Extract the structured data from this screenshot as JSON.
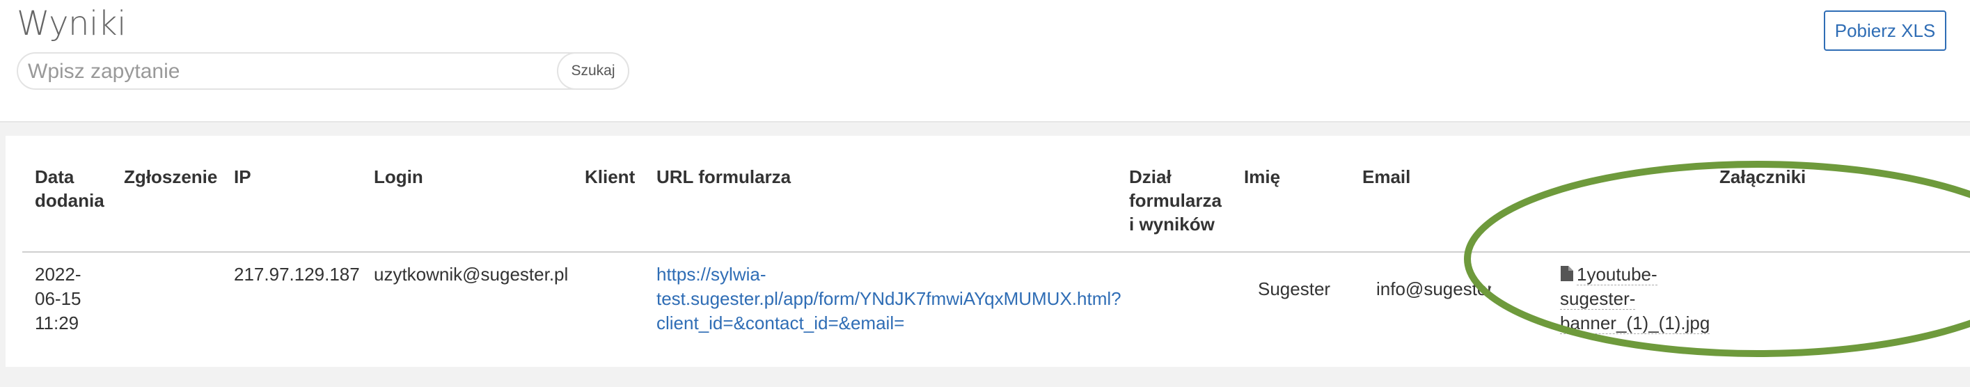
{
  "header": {
    "title": "Wyniki",
    "export_label": "Pobierz XLS"
  },
  "search": {
    "placeholder": "Wpisz zapytanie",
    "value": "",
    "button_label": "Szukaj"
  },
  "table": {
    "headers": {
      "date_line1": "Data",
      "date_line2": "dodania",
      "ticket": "Zgłoszenie",
      "ip": "IP",
      "login": "Login",
      "client": "Klient",
      "url": "URL formularza",
      "dept_line1": "Dział",
      "dept_line2": "formularza",
      "dept_line3": "i wyników",
      "name": "Imię",
      "email": "Email",
      "attachments": "Załączniki"
    },
    "rows": [
      {
        "date_line1": "2022-",
        "date_line2": "06-15",
        "date_line3": "11:29",
        "ticket": "",
        "ip": "217.97.129.187",
        "login": "uzytkownik@sugester.pl",
        "client": "",
        "url_line1": "https://sylwia-",
        "url_line2": "test.sugester.pl/app/form/YNdJK7fmwiAYqxMUMUX.html?",
        "url_line3": "client_id=&contact_id=&email=",
        "department": "",
        "name": "Sugester",
        "email": "info@sugester.pl",
        "attachment_line1": "1youtube-",
        "attachment_line2": "sugester-",
        "attachment_line3": "banner_(1)_(1).jpg",
        "attachment_icon": "file-icon"
      }
    ]
  },
  "annotation": {
    "shape": "ellipse",
    "color": "#6e9a3c"
  }
}
